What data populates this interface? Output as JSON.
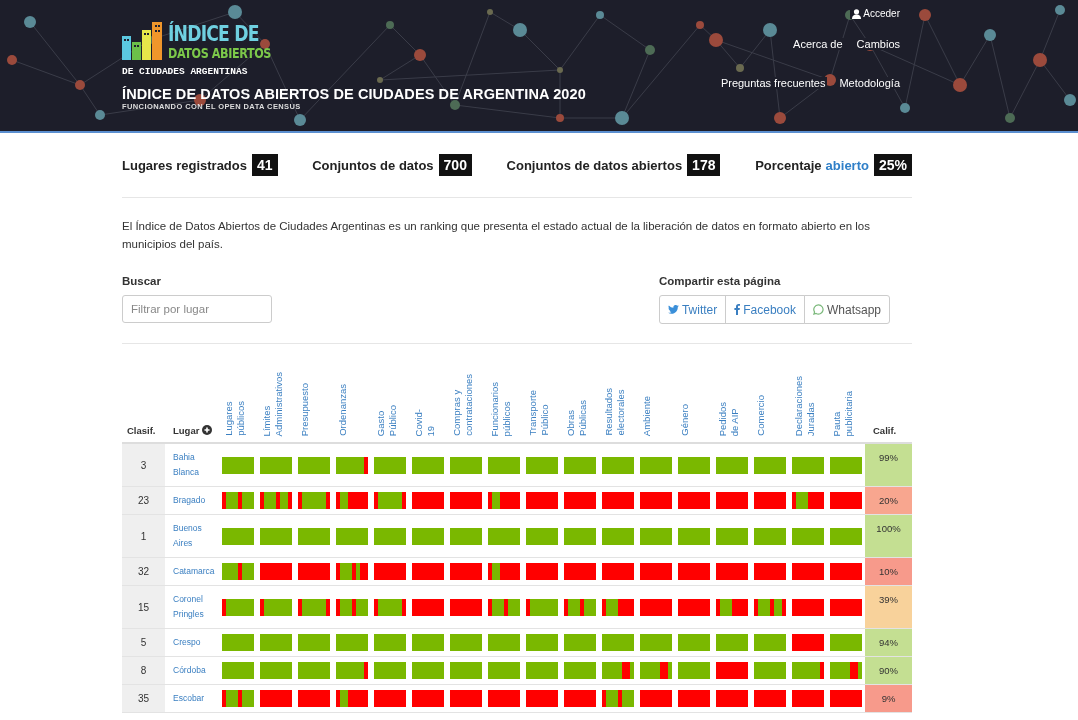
{
  "header": {
    "logo_line_1": "ÍNDICE DE",
    "logo_line_2": "DATOS ABIERTOS",
    "logo_line_3": "DE CIUDADES ARGENTINAS",
    "title": "ÍNDICE DE DATOS ABIERTOS DE CIUDADES DE ARGENTINA 2020",
    "subtitle": "FUNCIONANDO CON EL OPEN DATA CENSUS",
    "login": "Acceder",
    "nav_rows": [
      [
        "Acerca de",
        "Cambios"
      ],
      [
        "Preguntas frecuentes",
        "Metodología"
      ]
    ]
  },
  "stats": [
    {
      "label": "Lugares registrados",
      "value": "41"
    },
    {
      "label": "Conjuntos de datos",
      "value": "700"
    },
    {
      "label": "Conjuntos de datos abiertos",
      "value": "178"
    },
    {
      "label": "Porcentaje",
      "link": "abierto",
      "value": "25%"
    }
  ],
  "intro": "El Índice de Datos Abiertos de Ciudades Argentinas es un ranking que presenta el estado actual de la liberación de datos en formato abierto en los municipios del país.",
  "search": {
    "label": "Buscar",
    "placeholder": "Filtrar por lugar"
  },
  "share": {
    "label": "Compartir esta página",
    "buttons": [
      {
        "kind": "twitter",
        "label": "Twitter"
      },
      {
        "kind": "facebook",
        "label": "Facebook"
      },
      {
        "kind": "whatsapp",
        "label": "Whatsapp"
      }
    ]
  },
  "table": {
    "rank_header": "Clasif.",
    "place_header": "Lugar",
    "score_header": "Calif.",
    "columns": [
      "Lugares públicos",
      "Límites Administrativos",
      "Presupuesto",
      "Ordenanzas",
      "Gasto Público",
      "Covid-19",
      "Compras y contrataciones",
      "Funcionarios públicos",
      "Transporte Público",
      "Obras Públicas",
      "Resultados electorales",
      "Ambiente",
      "Género",
      "Pedidos de AIP",
      "Comercio",
      "Declaraciones Juradas",
      "Pauta publicitaria"
    ],
    "rows": [
      {
        "rank": "3",
        "place": "Bahia Blanca",
        "score": "99%",
        "color": "#c4df92",
        "cells": [
          [
            true,
            true,
            true,
            true,
            true,
            true,
            true,
            true
          ],
          [
            true,
            true,
            true,
            true,
            true,
            true,
            true,
            true
          ],
          [
            true,
            true,
            true,
            true,
            true,
            true,
            true,
            true
          ],
          [
            true,
            true,
            true,
            true,
            true,
            true,
            true,
            false
          ],
          [
            true,
            true,
            true,
            true,
            true,
            true,
            true,
            true
          ],
          [
            true,
            true,
            true,
            true,
            true,
            true,
            true,
            true
          ],
          [
            true,
            true,
            true,
            true,
            true,
            true,
            true,
            true
          ],
          [
            true,
            true,
            true,
            true,
            true,
            true,
            true,
            true
          ],
          [
            true,
            true,
            true,
            true,
            true,
            true,
            true,
            true
          ],
          [
            true,
            true,
            true,
            true,
            true,
            true,
            true,
            true
          ],
          [
            true,
            true,
            true,
            true,
            true,
            true,
            true,
            true
          ],
          [
            true,
            true,
            true,
            true,
            true,
            true,
            true,
            true
          ],
          [
            true,
            true,
            true,
            true,
            true,
            true,
            true,
            true
          ],
          [
            true,
            true,
            true,
            true,
            true,
            true,
            true,
            true
          ],
          [
            true,
            true,
            true,
            true,
            true,
            true,
            true,
            true
          ],
          [
            true,
            true,
            true,
            true,
            true,
            true,
            true,
            true
          ],
          [
            true,
            true,
            true,
            true,
            true,
            true,
            true,
            true
          ]
        ]
      },
      {
        "rank": "23",
        "place": "Bragado",
        "score": "20%",
        "color": "#f8a68f",
        "cells": [
          [
            false,
            true,
            true,
            true,
            false,
            true,
            true,
            true
          ],
          [
            false,
            true,
            true,
            true,
            false,
            true,
            true,
            false
          ],
          [
            false,
            true,
            true,
            true,
            true,
            true,
            true,
            false
          ],
          [
            false,
            true,
            true,
            false,
            false,
            false,
            false,
            false
          ],
          [
            false,
            true,
            true,
            true,
            true,
            true,
            true,
            false
          ],
          [
            false,
            false,
            false,
            false,
            false,
            false,
            false,
            false
          ],
          [
            false,
            false,
            false,
            false,
            false,
            false,
            false,
            false
          ],
          [
            false,
            true,
            true,
            false,
            false,
            false,
            false,
            false
          ],
          [
            false,
            false,
            false,
            false,
            false,
            false,
            false,
            false
          ],
          [
            false,
            false,
            false,
            false,
            false,
            false,
            false,
            false
          ],
          [
            false,
            false,
            false,
            false,
            false,
            false,
            false,
            false
          ],
          [
            false,
            false,
            false,
            false,
            false,
            false,
            false,
            false
          ],
          [
            false,
            false,
            false,
            false,
            false,
            false,
            false,
            false
          ],
          [
            false,
            false,
            false,
            false,
            false,
            false,
            false,
            false
          ],
          [
            false,
            false,
            false,
            false,
            false,
            false,
            false,
            false
          ],
          [
            false,
            true,
            true,
            true,
            false,
            false,
            false,
            false
          ],
          [
            false,
            false,
            false,
            false,
            false,
            false,
            false,
            false
          ]
        ]
      },
      {
        "rank": "1",
        "place": "Buenos Aires",
        "score": "100%",
        "color": "#c4df92",
        "cells": [
          [
            true,
            true,
            true,
            true,
            true,
            true,
            true,
            true
          ],
          [
            true,
            true,
            true,
            true,
            true,
            true,
            true,
            true
          ],
          [
            true,
            true,
            true,
            true,
            true,
            true,
            true,
            true
          ],
          [
            true,
            true,
            true,
            true,
            true,
            true,
            true,
            true
          ],
          [
            true,
            true,
            true,
            true,
            true,
            true,
            true,
            true
          ],
          [
            true,
            true,
            true,
            true,
            true,
            true,
            true,
            true
          ],
          [
            true,
            true,
            true,
            true,
            true,
            true,
            true,
            true
          ],
          [
            true,
            true,
            true,
            true,
            true,
            true,
            true,
            true
          ],
          [
            true,
            true,
            true,
            true,
            true,
            true,
            true,
            true
          ],
          [
            true,
            true,
            true,
            true,
            true,
            true,
            true,
            true
          ],
          [
            true,
            true,
            true,
            true,
            true,
            true,
            true,
            true
          ],
          [
            true,
            true,
            true,
            true,
            true,
            true,
            true,
            true
          ],
          [
            true,
            true,
            true,
            true,
            true,
            true,
            true,
            true
          ],
          [
            true,
            true,
            true,
            true,
            true,
            true,
            true,
            true
          ],
          [
            true,
            true,
            true,
            true,
            true,
            true,
            true,
            true
          ],
          [
            true,
            true,
            true,
            true,
            true,
            true,
            true,
            true
          ],
          [
            true,
            true,
            true,
            true,
            true,
            true,
            true,
            true
          ]
        ]
      },
      {
        "rank": "32",
        "place": "Catamarca",
        "score": "10%",
        "color": "#f79a8b",
        "cells": [
          [
            true,
            true,
            true,
            true,
            false,
            true,
            true,
            true
          ],
          [
            false,
            false,
            false,
            false,
            false,
            false,
            false,
            false
          ],
          [
            false,
            false,
            false,
            false,
            false,
            false,
            false,
            false
          ],
          [
            false,
            true,
            true,
            true,
            false,
            true,
            false,
            false
          ],
          [
            false,
            false,
            false,
            false,
            false,
            false,
            false,
            false
          ],
          [
            false,
            false,
            false,
            false,
            false,
            false,
            false,
            false
          ],
          [
            false,
            false,
            false,
            false,
            false,
            false,
            false,
            false
          ],
          [
            false,
            true,
            true,
            false,
            false,
            false,
            false,
            false
          ],
          [
            false,
            false,
            false,
            false,
            false,
            false,
            false,
            false
          ],
          [
            false,
            false,
            false,
            false,
            false,
            false,
            false,
            false
          ],
          [
            false,
            false,
            false,
            false,
            false,
            false,
            false,
            false
          ],
          [
            false,
            false,
            false,
            false,
            false,
            false,
            false,
            false
          ],
          [
            false,
            false,
            false,
            false,
            false,
            false,
            false,
            false
          ],
          [
            false,
            false,
            false,
            false,
            false,
            false,
            false,
            false
          ],
          [
            false,
            false,
            false,
            false,
            false,
            false,
            false,
            false
          ],
          [
            false,
            false,
            false,
            false,
            false,
            false,
            false,
            false
          ],
          [
            false,
            false,
            false,
            false,
            false,
            false,
            false,
            false
          ]
        ]
      },
      {
        "rank": "15",
        "place": "Coronel Pringles",
        "score": "39%",
        "color": "#f8d29b",
        "cells": [
          [
            false,
            true,
            true,
            true,
            true,
            true,
            true,
            true
          ],
          [
            false,
            true,
            true,
            true,
            true,
            true,
            true,
            true
          ],
          [
            false,
            true,
            true,
            true,
            true,
            true,
            true,
            false
          ],
          [
            false,
            true,
            true,
            true,
            false,
            true,
            true,
            true
          ],
          [
            false,
            true,
            true,
            true,
            true,
            true,
            true,
            false
          ],
          [
            false,
            false,
            false,
            false,
            false,
            false,
            false,
            false
          ],
          [
            false,
            false,
            false,
            false,
            false,
            false,
            false,
            false
          ],
          [
            false,
            true,
            true,
            true,
            false,
            true,
            true,
            true
          ],
          [
            false,
            true,
            true,
            true,
            true,
            true,
            true,
            true
          ],
          [
            false,
            true,
            true,
            true,
            false,
            true,
            true,
            true
          ],
          [
            false,
            true,
            true,
            true,
            false,
            false,
            false,
            false
          ],
          [
            false,
            false,
            false,
            false,
            false,
            false,
            false,
            false
          ],
          [
            false,
            false,
            false,
            false,
            false,
            false,
            false,
            false
          ],
          [
            false,
            true,
            true,
            true,
            false,
            false,
            false,
            false
          ],
          [
            false,
            true,
            true,
            true,
            false,
            true,
            true,
            false
          ],
          [
            false,
            false,
            false,
            false,
            false,
            false,
            false,
            false
          ],
          [
            false,
            false,
            false,
            false,
            false,
            false,
            false,
            false
          ]
        ]
      },
      {
        "rank": "5",
        "place": "Crespo",
        "score": "94%",
        "color": "#c4df92",
        "cells": [
          [
            true,
            true,
            true,
            true,
            true,
            true,
            true,
            true
          ],
          [
            true,
            true,
            true,
            true,
            true,
            true,
            true,
            true
          ],
          [
            true,
            true,
            true,
            true,
            true,
            true,
            true,
            true
          ],
          [
            true,
            true,
            true,
            true,
            true,
            true,
            true,
            true
          ],
          [
            true,
            true,
            true,
            true,
            true,
            true,
            true,
            true
          ],
          [
            true,
            true,
            true,
            true,
            true,
            true,
            true,
            true
          ],
          [
            true,
            true,
            true,
            true,
            true,
            true,
            true,
            true
          ],
          [
            true,
            true,
            true,
            true,
            true,
            true,
            true,
            true
          ],
          [
            true,
            true,
            true,
            true,
            true,
            true,
            true,
            true
          ],
          [
            true,
            true,
            true,
            true,
            true,
            true,
            true,
            true
          ],
          [
            true,
            true,
            true,
            true,
            true,
            true,
            true,
            true
          ],
          [
            true,
            true,
            true,
            true,
            true,
            true,
            true,
            true
          ],
          [
            true,
            true,
            true,
            true,
            true,
            true,
            true,
            true
          ],
          [
            true,
            true,
            true,
            true,
            true,
            true,
            true,
            true
          ],
          [
            true,
            true,
            true,
            true,
            true,
            true,
            true,
            true
          ],
          [
            false,
            false,
            false,
            false,
            false,
            false,
            false,
            false
          ],
          [
            true,
            true,
            true,
            true,
            true,
            true,
            true,
            true
          ]
        ]
      },
      {
        "rank": "8",
        "place": "Córdoba",
        "score": "90%",
        "color": "#c4df92",
        "cells": [
          [
            true,
            true,
            true,
            true,
            true,
            true,
            true,
            true
          ],
          [
            true,
            true,
            true,
            true,
            true,
            true,
            true,
            true
          ],
          [
            true,
            true,
            true,
            true,
            true,
            true,
            true,
            true
          ],
          [
            true,
            true,
            true,
            true,
            true,
            true,
            true,
            false
          ],
          [
            true,
            true,
            true,
            true,
            true,
            true,
            true,
            true
          ],
          [
            true,
            true,
            true,
            true,
            true,
            true,
            true,
            true
          ],
          [
            true,
            true,
            true,
            true,
            true,
            true,
            true,
            true
          ],
          [
            true,
            true,
            true,
            true,
            true,
            true,
            true,
            true
          ],
          [
            true,
            true,
            true,
            true,
            true,
            true,
            true,
            true
          ],
          [
            true,
            true,
            true,
            true,
            true,
            true,
            true,
            true
          ],
          [
            true,
            true,
            true,
            true,
            true,
            false,
            false,
            true
          ],
          [
            true,
            true,
            true,
            true,
            true,
            false,
            false,
            true
          ],
          [
            true,
            true,
            true,
            true,
            true,
            true,
            true,
            true
          ],
          [
            false,
            false,
            false,
            false,
            false,
            false,
            false,
            false
          ],
          [
            true,
            true,
            true,
            true,
            true,
            true,
            true,
            true
          ],
          [
            true,
            true,
            true,
            true,
            true,
            true,
            true,
            false
          ],
          [
            true,
            true,
            true,
            true,
            true,
            false,
            false,
            true
          ]
        ]
      },
      {
        "rank": "35",
        "place": "Escobar",
        "score": "9%",
        "color": "#f79a8b",
        "cells": [
          [
            false,
            true,
            true,
            true,
            false,
            true,
            true,
            true
          ],
          [
            false,
            false,
            false,
            false,
            false,
            false,
            false,
            false
          ],
          [
            false,
            false,
            false,
            false,
            false,
            false,
            false,
            false
          ],
          [
            false,
            true,
            true,
            false,
            false,
            false,
            false,
            false
          ],
          [
            false,
            false,
            false,
            false,
            false,
            false,
            false,
            false
          ],
          [
            false,
            false,
            false,
            false,
            false,
            false,
            false,
            false
          ],
          [
            false,
            false,
            false,
            false,
            false,
            false,
            false,
            false
          ],
          [
            false,
            false,
            false,
            false,
            false,
            false,
            false,
            false
          ],
          [
            false,
            false,
            false,
            false,
            false,
            false,
            false,
            false
          ],
          [
            false,
            false,
            false,
            false,
            false,
            false,
            false,
            false
          ],
          [
            false,
            true,
            true,
            true,
            false,
            true,
            true,
            true
          ],
          [
            false,
            false,
            false,
            false,
            false,
            false,
            false,
            false
          ],
          [
            false,
            false,
            false,
            false,
            false,
            false,
            false,
            false
          ],
          [
            false,
            false,
            false,
            false,
            false,
            false,
            false,
            false
          ],
          [
            false,
            false,
            false,
            false,
            false,
            false,
            false,
            false
          ],
          [
            false,
            false,
            false,
            false,
            false,
            false,
            false,
            false
          ],
          [
            false,
            false,
            false,
            false,
            false,
            false,
            false,
            false
          ]
        ]
      }
    ]
  }
}
